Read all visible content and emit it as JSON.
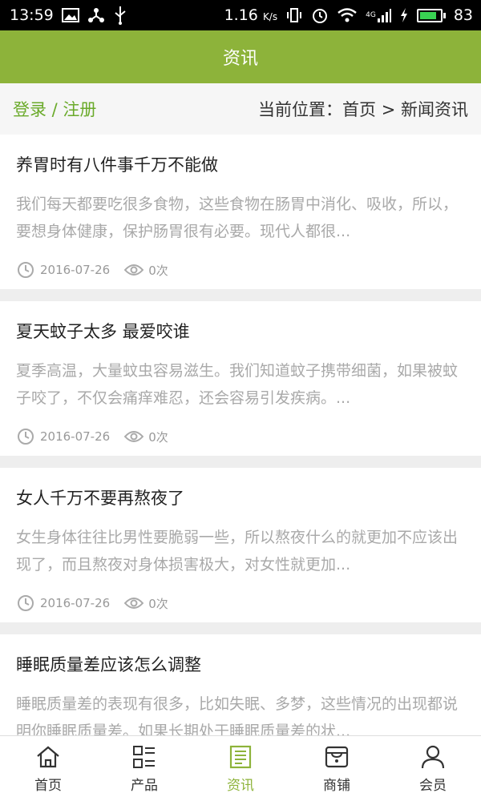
{
  "status_bar": {
    "time": "13:59",
    "speed": "1.16",
    "speed_unit": "K/s",
    "battery": "83",
    "battery_level_percent": 83,
    "network": "4G"
  },
  "header": {
    "title": "资讯"
  },
  "subbar": {
    "login": "登录 / 注册",
    "location_label": "当前位置：",
    "home": "首页",
    "separator": ">",
    "current": "新闻资讯"
  },
  "articles": [
    {
      "title": "养胃时有八件事千万不能做",
      "summary": "我们每天都要吃很多食物，这些食物在肠胃中消化、吸收，所以，要想身体健康，保护肠胃很有必要。现代人都很...",
      "date": "2016-07-26",
      "views": "0次"
    },
    {
      "title": "夏天蚊子太多 最爱咬谁",
      "summary": "夏季高温，大量蚊虫容易滋生。我们知道蚊子携带细菌，如果被蚊子咬了，不仅会痛痒难忍，还会容易引发疾病。...",
      "date": "2016-07-26",
      "views": "0次"
    },
    {
      "title": "女人千万不要再熬夜了",
      "summary": "女生身体往往比男性要脆弱一些，所以熬夜什么的就更加不应该出现了，而且熬夜对身体损害极大，对女性就更加...",
      "date": "2016-07-26",
      "views": "0次"
    },
    {
      "title": "睡眠质量差应该怎么调整",
      "summary": "睡眠质量差的表现有很多，比如失眠、多梦，这些情况的出现都说明你睡眠质量差。如果长期处于睡眠质量差的状...",
      "date": "",
      "views": ""
    }
  ],
  "tabs": [
    {
      "label": "首页",
      "icon": "home-icon"
    },
    {
      "label": "产品",
      "icon": "grid-list-icon"
    },
    {
      "label": "资讯",
      "icon": "news-icon"
    },
    {
      "label": "商铺",
      "icon": "store-icon"
    },
    {
      "label": "会员",
      "icon": "user-icon"
    }
  ],
  "colors": {
    "accent": "#8db33a",
    "login": "#6aaa2a",
    "summary_text": "#a9a9a9"
  }
}
